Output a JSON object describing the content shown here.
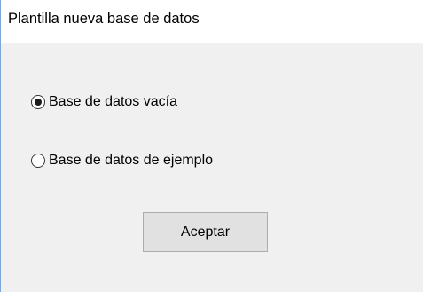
{
  "window": {
    "title": "Plantilla nueva base de datos"
  },
  "options": [
    {
      "label": "Base de datos vacía",
      "selected": true
    },
    {
      "label": "Base de datos de ejemplo",
      "selected": false
    }
  ],
  "actions": {
    "accept_label": "Aceptar"
  },
  "colors": {
    "title_background": "#ffffff",
    "dialog_background": "#f0f0f0",
    "window_border": "#7aa9d9",
    "button_background": "#e1e1e1",
    "button_border": "#adadad"
  }
}
